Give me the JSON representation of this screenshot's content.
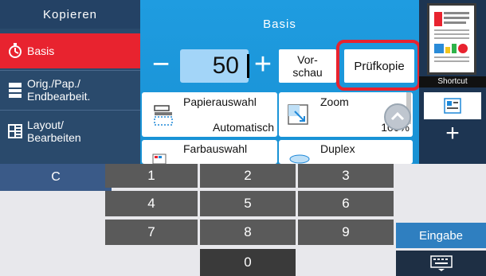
{
  "sidebar": {
    "title": "Kopieren",
    "items": [
      {
        "label": "Basis",
        "icon": "stopwatch-icon",
        "selected": true
      },
      {
        "label": "Orig./Pap./\nEndbearbeit.",
        "icon": "document-stack-icon"
      },
      {
        "label": "Layout/\nBearbeiten",
        "icon": "layout-icon"
      }
    ]
  },
  "center": {
    "title": "Basis",
    "minus": "−",
    "plus": "+",
    "quantity": "50",
    "vorschau_label": "Vor-\nschau",
    "pruefkopie_label": "Prüfkopie",
    "cards": [
      {
        "title": "Papierauswahl",
        "value": "Automatisch"
      },
      {
        "title": "Zoom",
        "value": "100%"
      },
      {
        "title": "Farbauswahl",
        "value": ""
      },
      {
        "title": "Duplex",
        "value": ""
      }
    ]
  },
  "right": {
    "shortcut_label": "Shortcut",
    "add_label": "+"
  },
  "keypad": {
    "clear": "C",
    "keys": [
      "1",
      "2",
      "3",
      "4",
      "5",
      "6",
      "7",
      "8",
      "9",
      "0"
    ],
    "enter": "Eingabe"
  },
  "colors": {
    "accent": "#1f9ce0",
    "selected": "#e8232f",
    "panel": "#2f4e72"
  }
}
